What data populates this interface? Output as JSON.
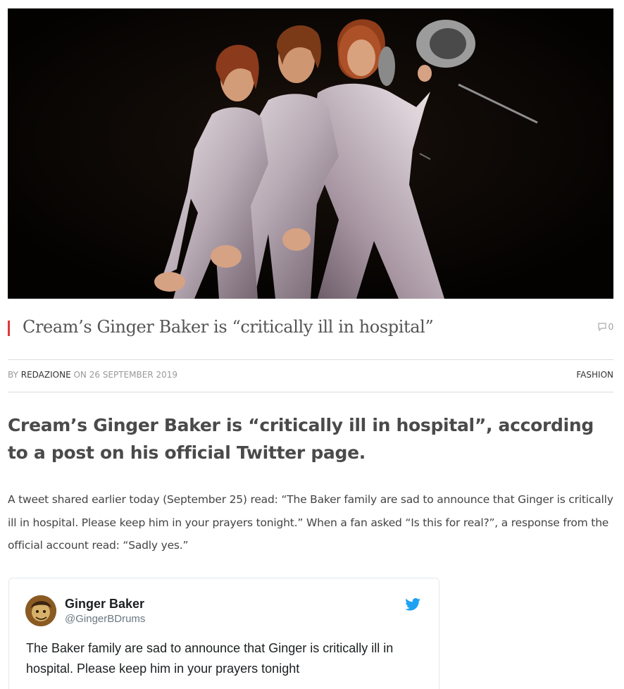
{
  "hero": {
    "alt": "Three men in silver satin suits on a dark stage"
  },
  "post": {
    "title": "Cream’s Ginger Baker is “critically ill in hospital”",
    "comment_count": "0",
    "meta": {
      "by_label": "BY",
      "author": "REDAZIONE",
      "on_label": "ON",
      "date": "26 SEPTEMBER 2019",
      "category": "FASHION"
    },
    "lead": "Cream’s Ginger Baker is “critically ill in hospital”, according to a post on his official Twitter page.",
    "body": "A tweet shared earlier today (September 25) read: “The Baker family are sad to announce that Ginger is critically ill in hospital. Please keep him in your prayers tonight.” When a fan asked “Is this for real?”, a response from the official account read: “Sadly yes.”"
  },
  "tweet": {
    "name": "Ginger Baker",
    "handle": "@GingerBDrums",
    "text": "The Baker family are sad to announce that Ginger is critically ill in hospital. Please keep him in your prayers tonight",
    "footer": ""
  },
  "icons": {
    "comment": "comment-bubble-icon",
    "twitter": "twitter-bird-icon"
  },
  "colors": {
    "accent": "#e0383a",
    "twitter_blue": "#1da1f2"
  }
}
